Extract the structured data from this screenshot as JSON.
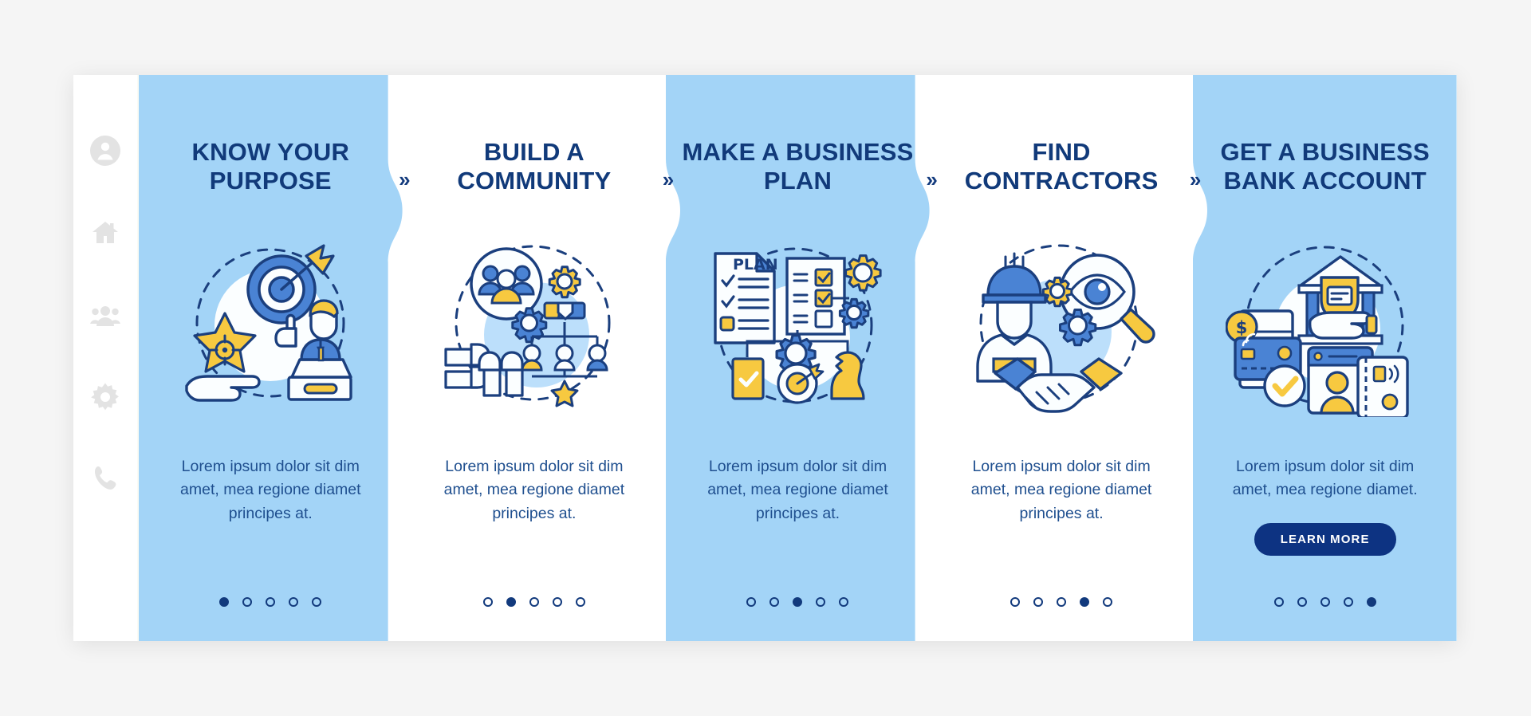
{
  "theme": {
    "page_bg": "#f5f5f5",
    "card_bg": "#ffffff",
    "panel_blue": "#a3d4f7",
    "panel_white": "#ffffff",
    "title_color": "#113a7a",
    "body_color": "#1f4f8f",
    "accent_navy": "#0d3382",
    "accent_blue": "#4a83d4",
    "accent_yellow": "#f7c940",
    "rail_icon_color": "#e3e3e3"
  },
  "sidebar": {
    "items": [
      {
        "name": "profile-icon",
        "label": "Profile"
      },
      {
        "name": "home-icon",
        "label": "Home"
      },
      {
        "name": "people-icon",
        "label": "People"
      },
      {
        "name": "gear-icon",
        "label": "Settings"
      },
      {
        "name": "phone-icon",
        "label": "Contact"
      }
    ]
  },
  "separators": [
    {
      "glyph": "»",
      "name": "chevron-next-1"
    },
    {
      "glyph": "»",
      "name": "chevron-next-2"
    },
    {
      "glyph": "»",
      "name": "chevron-next-3"
    },
    {
      "glyph": "»",
      "name": "chevron-next-4"
    }
  ],
  "panels": [
    {
      "title": "KNOW YOUR PURPOSE",
      "description": "Lorem ipsum dolor sit dim amet, mea regione diamet principes at.",
      "illustration": "target-arrow-star-hand-speaker-illustration",
      "background": "blue",
      "dots": {
        "count": 5,
        "active": 1
      },
      "cta": null
    },
    {
      "title": "BUILD A COMMUNITY",
      "description": "Lorem ipsum dolor sit dim amet, mea regione diamet principes at.",
      "illustration": "people-gears-teamwork-orgchart-illustration",
      "background": "white",
      "dots": {
        "count": 5,
        "active": 2
      },
      "cta": null
    },
    {
      "title": "MAKE A BUSINESS PLAN",
      "description": "Lorem ipsum dolor sit dim amet, mea regione diamet principes at.",
      "illustration": "plan-checklist-gears-knight-illustration",
      "background": "blue",
      "dots": {
        "count": 5,
        "active": 3
      },
      "cta": null
    },
    {
      "title": "FIND CONTRACTORS",
      "description": "Lorem ipsum dolor sit dim amet, mea regione diamet principes at.",
      "illustration": "worker-magnifier-handshake-illustration",
      "background": "white",
      "dots": {
        "count": 5,
        "active": 4
      },
      "cta": null
    },
    {
      "title": "GET A BUSINESS BANK ACCOUNT",
      "description": "Lorem ipsum dolor sit dim amet, mea regione diamet.",
      "illustration": "bank-cards-shield-profile-illustration",
      "background": "blue",
      "dots": {
        "count": 5,
        "active": 5
      },
      "cta": "LEARN MORE"
    }
  ]
}
